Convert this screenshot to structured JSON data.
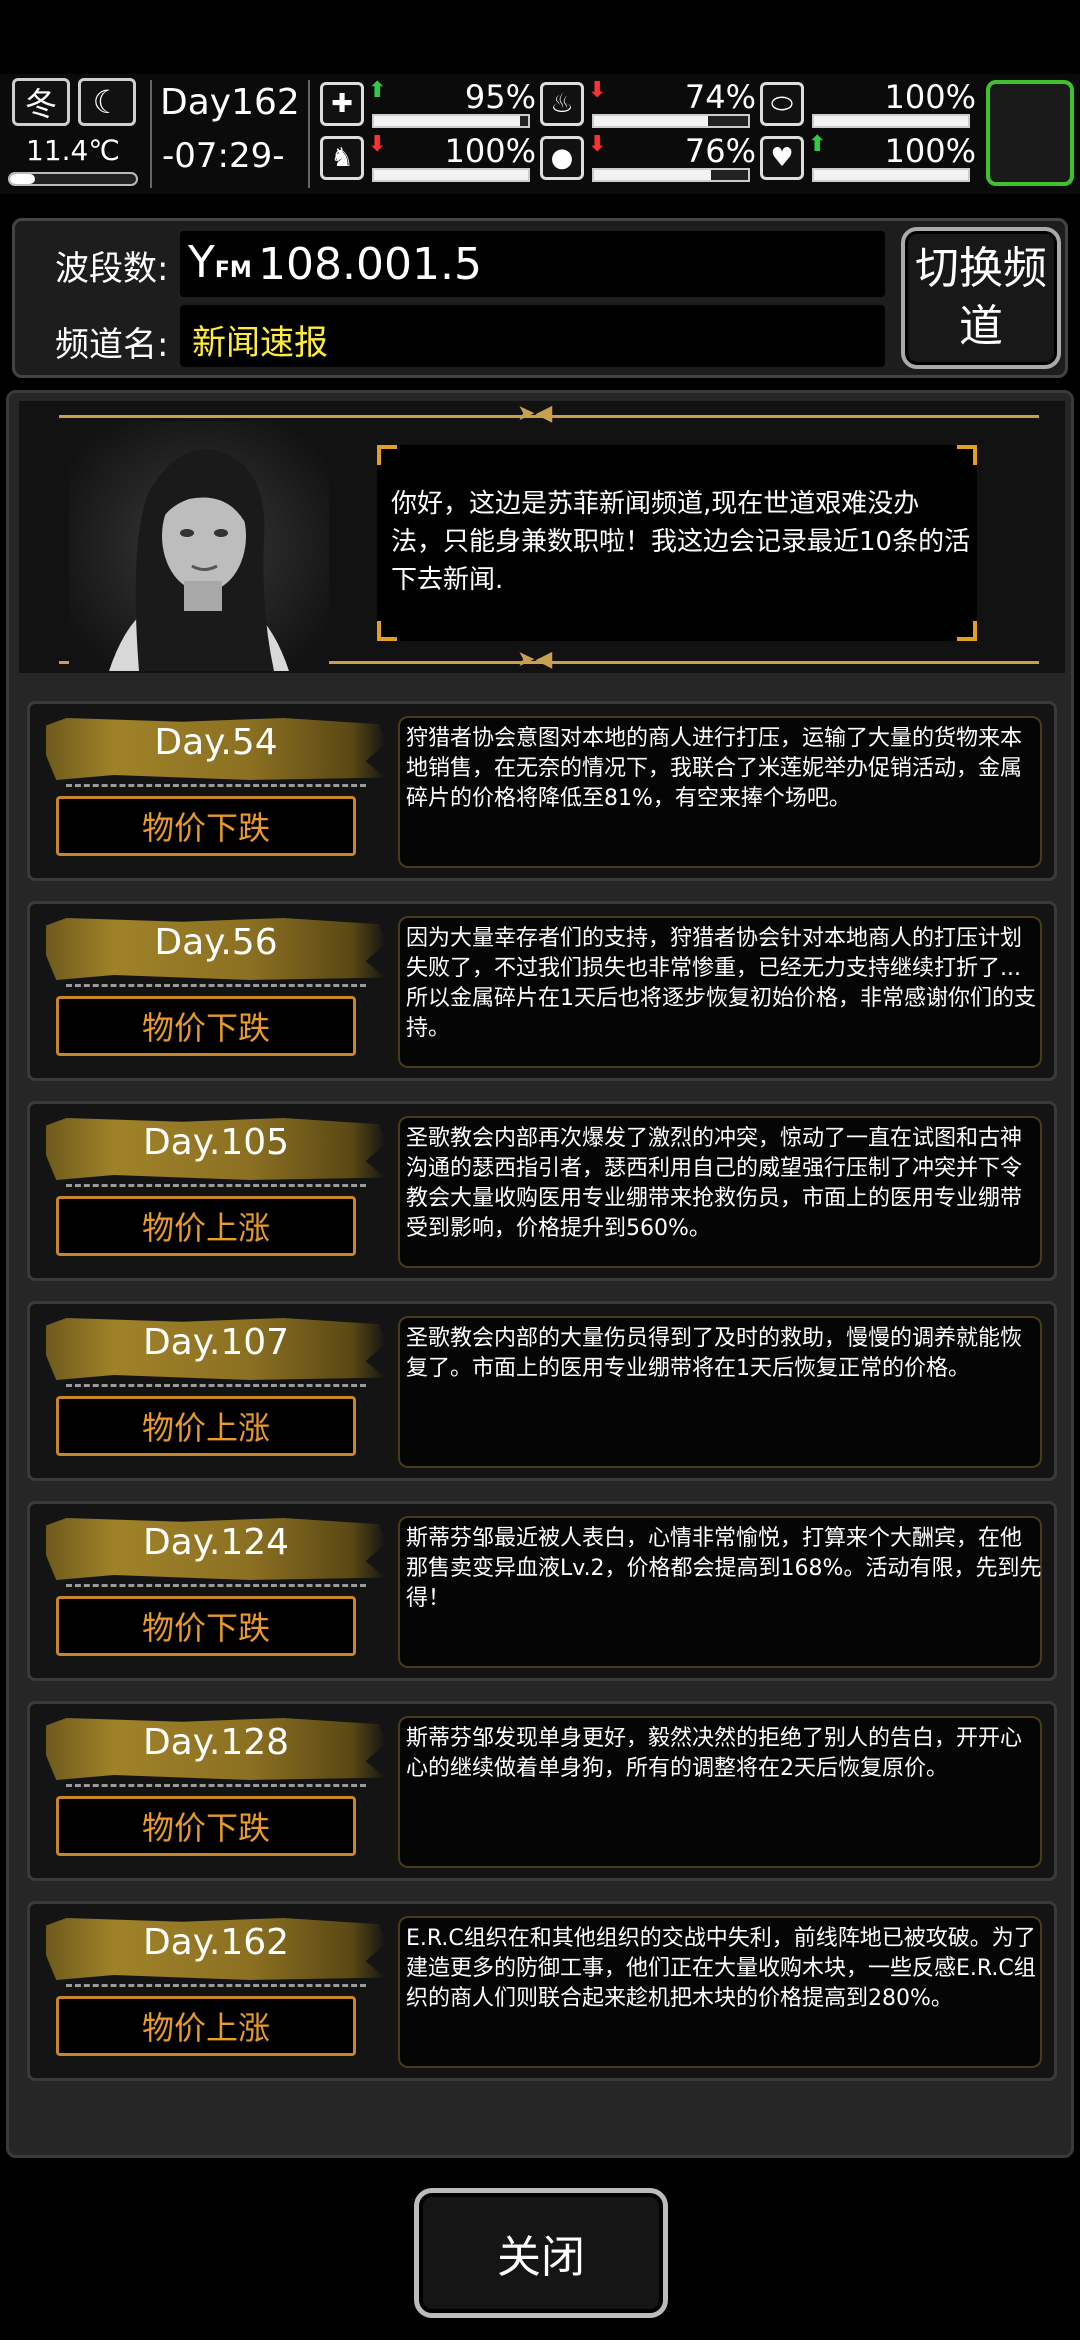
{
  "status": {
    "season": "冬",
    "moon_icon": "crescent-moon-icon",
    "temperature": "11.4℃",
    "temperature_level": 0.2,
    "day": "Day162",
    "time": "-07:29-",
    "stats": [
      {
        "icon": "medkit-icon",
        "glyph": "✚",
        "trend": "up",
        "value": "95%",
        "level": 0.95
      },
      {
        "icon": "stomach-icon",
        "glyph": "♨",
        "trend": "down",
        "value": "74%",
        "level": 0.74
      },
      {
        "icon": "capsule-icon",
        "glyph": "⬭",
        "trend": "none",
        "value": "100%",
        "level": 1.0
      },
      {
        "icon": "leg-icon",
        "glyph": "♞",
        "trend": "down",
        "value": "100%",
        "level": 1.0
      },
      {
        "icon": "water-drop-icon",
        "glyph": "●",
        "trend": "down",
        "value": "76%",
        "level": 0.76
      },
      {
        "icon": "heart-icon",
        "glyph": "♥",
        "trend": "up",
        "value": "100%",
        "level": 1.0
      }
    ]
  },
  "radio": {
    "band_label": "波段数:",
    "frequency": "108.001.5",
    "antenna_icon": "fm-antenna-icon",
    "antenna_glyph": "Y",
    "fm_text": "FM",
    "channel_label": "频道名:",
    "channel_name": "新闻速报",
    "switch_button": "切换频道"
  },
  "host": {
    "message": "你好，这边是苏菲新闻频道,现在世道艰难没办法，只能身兼数职啦！我这边会记录最近10条的活下去新闻."
  },
  "news": [
    {
      "day": "Day.54",
      "tag": "物价下跌",
      "text": "狩猎者协会意图对本地的商人进行打压，运输了大量的货物来本地销售，在无奈的情况下，我联合了米莲妮举办促销活动，金属碎片的价格将降低至81%，有空来捧个场吧。"
    },
    {
      "day": "Day.56",
      "tag": "物价下跌",
      "text": "因为大量幸存者们的支持，狩猎者协会针对本地商人的打压计划失败了，不过我们损失也非常惨重，已经无力支持继续打折了...所以金属碎片在1天后也将逐步恢复初始价格，非常感谢你们的支持。"
    },
    {
      "day": "Day.105",
      "tag": "物价上涨",
      "text": "圣歌教会内部再次爆发了激烈的冲突，惊动了一直在试图和古神沟通的瑟西指引者，瑟西利用自己的威望强行压制了冲突并下令教会大量收购医用专业绷带来抢救伤员，市面上的医用专业绷带受到影响，价格提升到560%。"
    },
    {
      "day": "Day.107",
      "tag": "物价上涨",
      "text": "圣歌教会内部的大量伤员得到了及时的救助，慢慢的调养就能恢复了。市面上的医用专业绷带将在1天后恢复正常的价格。"
    },
    {
      "day": "Day.124",
      "tag": "物价下跌",
      "text": "斯蒂芬邹最近被人表白，心情非常愉悦，打算来个大酬宾，在他那售卖变异血液Lv.2，价格都会提高到168%。活动有限，先到先得！"
    },
    {
      "day": "Day.128",
      "tag": "物价下跌",
      "text": "斯蒂芬邹发现单身更好，毅然决然的拒绝了别人的告白，开开心心的继续做着单身狗，所有的调整将在2天后恢复原价。"
    },
    {
      "day": "Day.162",
      "tag": "物价上涨",
      "text": "E.R.C组织在和其他组织的交战中失利，前线阵地已被攻破。为了建造更多的防御工事，他们正在大量收购木块，一些反感E.R.C组织的商人们则联合起来趁机把木块的价格提高到280%。"
    }
  ],
  "close_button": "关闭",
  "colors": {
    "accent_gold": "#c8a050",
    "tag_orange": "#e89a2a",
    "channel_yellow": "#ffec3d",
    "active_green": "#3fc22c"
  }
}
